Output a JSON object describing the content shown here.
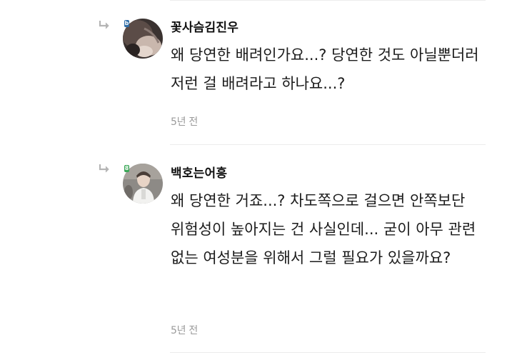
{
  "comments": [
    {
      "username": "꽃사슴김진우",
      "text": "왜 당연한 배려인가요...? 당연한 것도 아닐뿐더러 저런 걸 배려라고 하나요...?",
      "time": "5년 전",
      "badge_color": "#2f6ea8"
    },
    {
      "username": "백호는어흥",
      "text": "왜 당연한 거죠...? 차도쪽으로 걸으면 안쪽보단 위험성이 높아지는 건 사실인데... 굳이 아무 관련 없는 여성분을 위해서 그럴 필요가 있을까요?",
      "time": "5년 전",
      "badge_color": "#3aa757"
    }
  ],
  "icons": {
    "reply": "reply-arrow-icon",
    "badge": "level-badge-icon"
  }
}
